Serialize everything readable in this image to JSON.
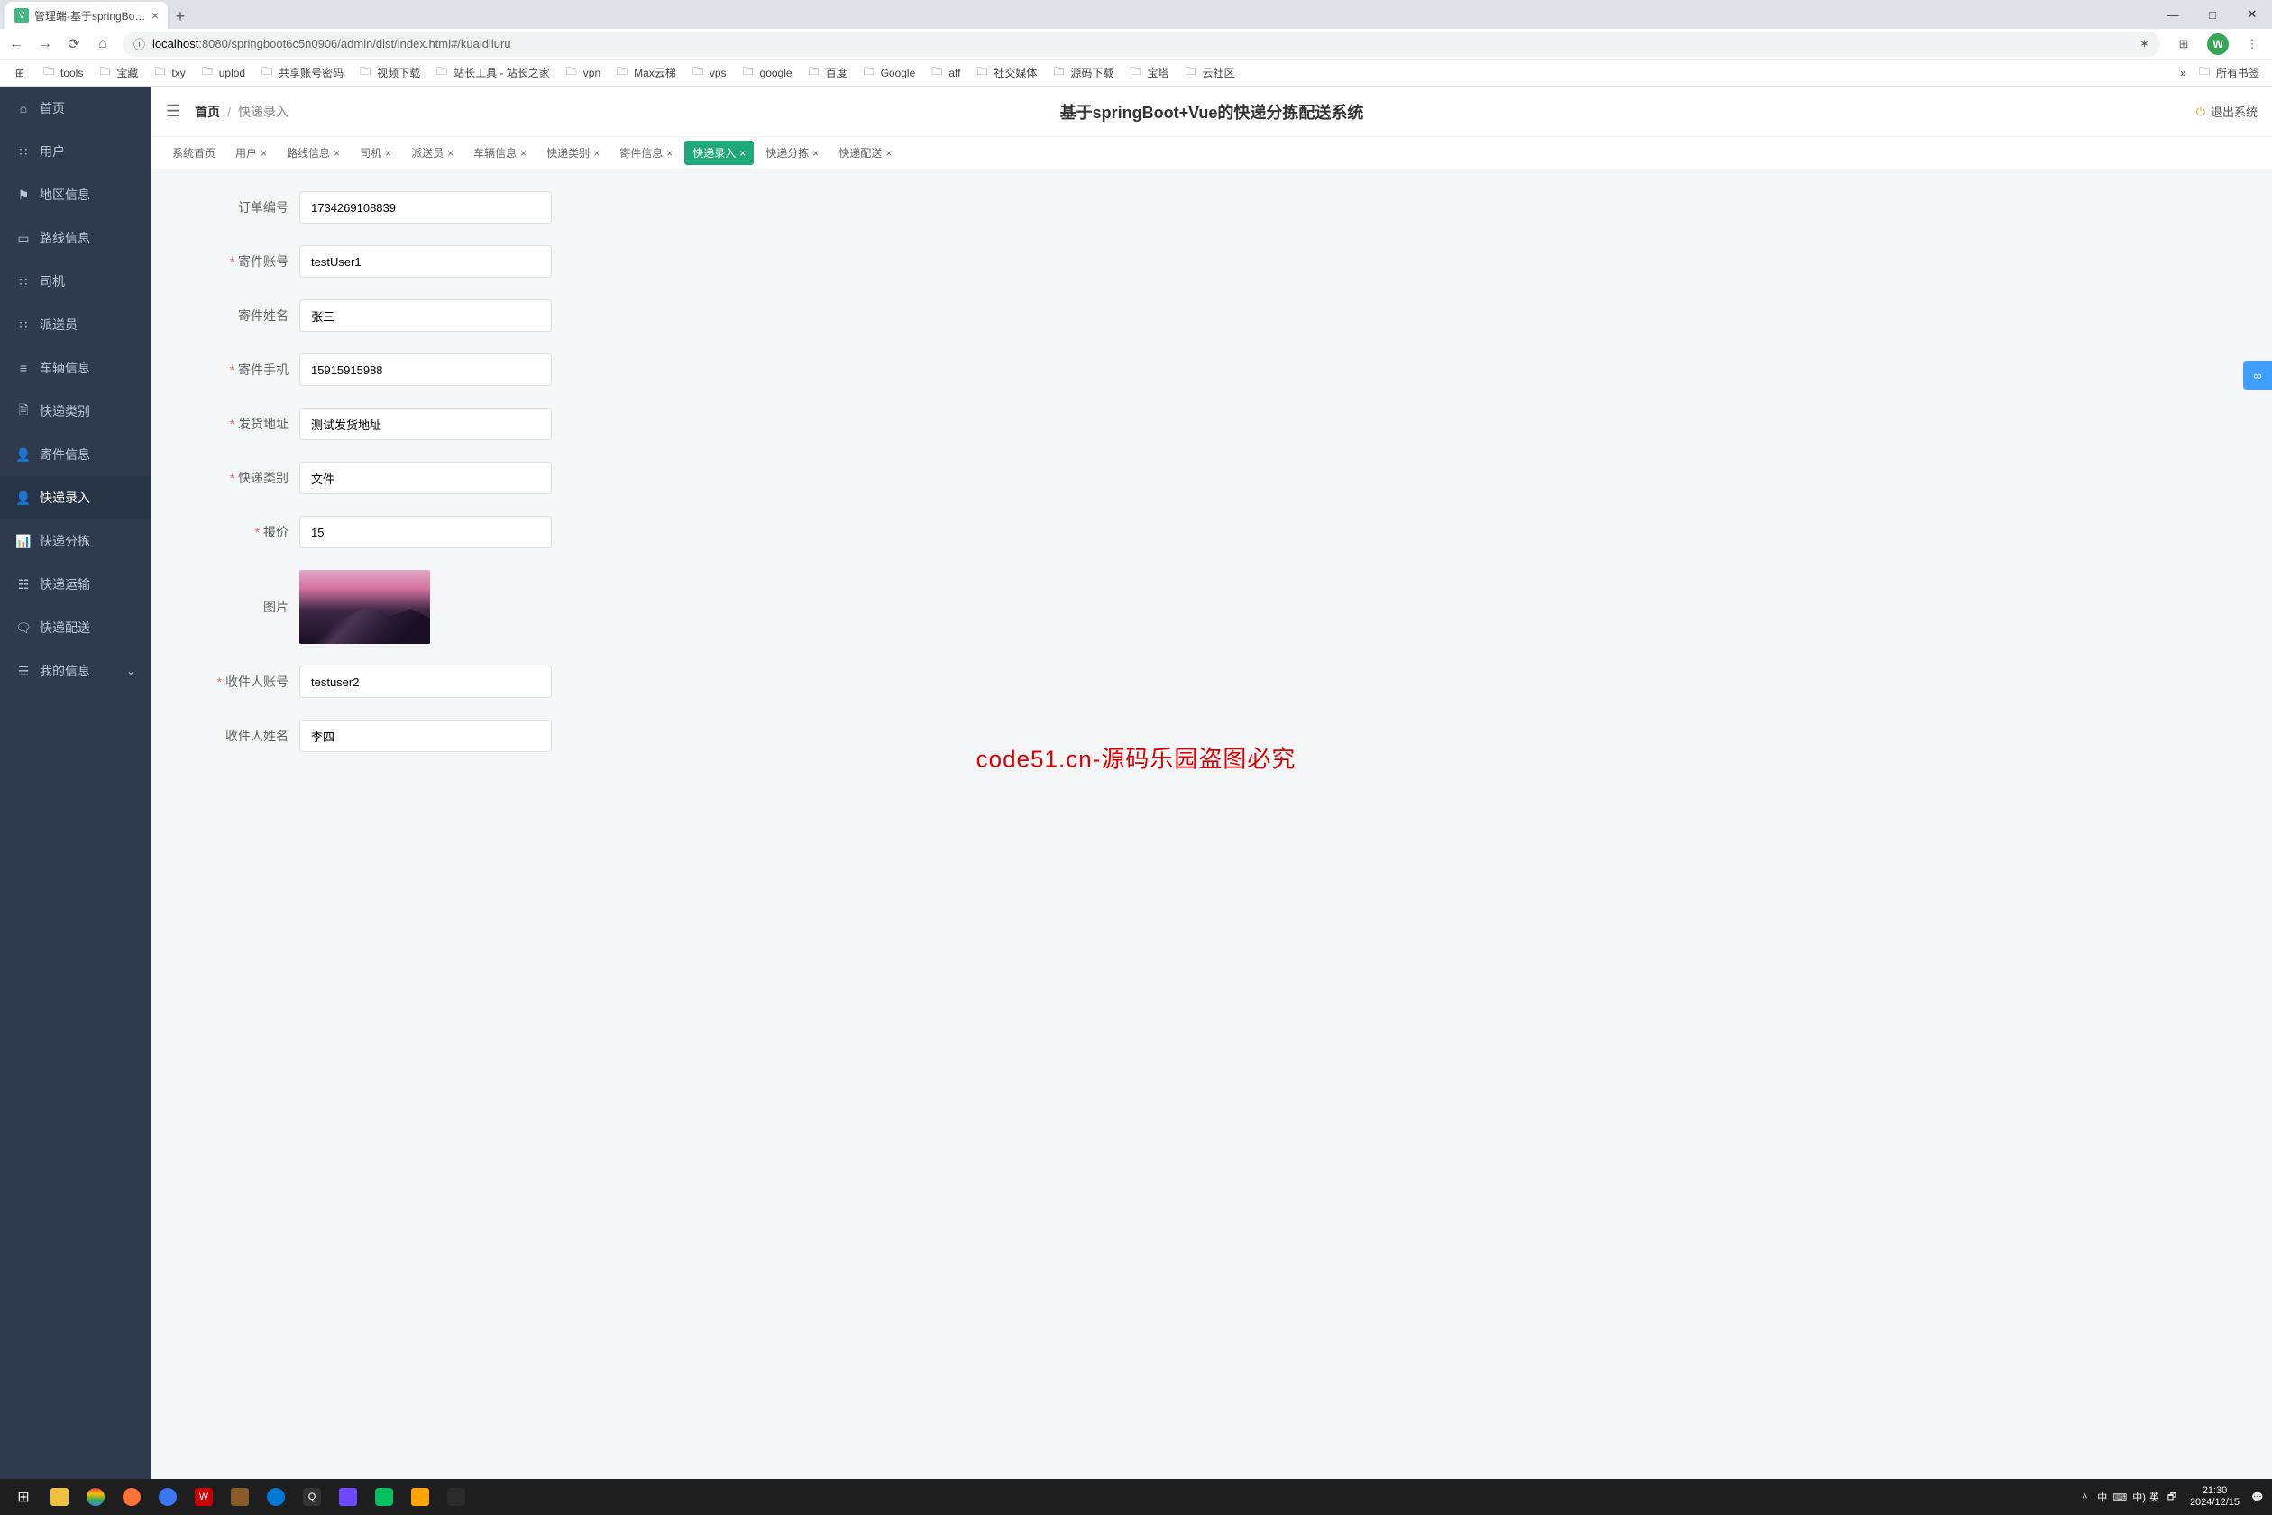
{
  "browser": {
    "tab_title": "管理端-基于springBoot+Vue的...",
    "url_host": "localhost",
    "url_path": ":8080/springboot6c5n0906/admin/dist/index.html#/kuaidiluru",
    "avatar_letter": "W"
  },
  "bookmarks": [
    "tools",
    "宝藏",
    "txy",
    "uplod",
    "共享账号密码",
    "视频下载",
    "站长工具 - 站长之家",
    "vpn",
    "Max云梯",
    "vps",
    "google",
    "百度",
    "Google",
    "aff",
    "社交媒体",
    "源码下载",
    "宝塔",
    "云社区"
  ],
  "bookmarks_more": "所有书签",
  "sidebar": [
    {
      "icon": "⌂",
      "label": "首页"
    },
    {
      "icon": "∷",
      "label": "用户"
    },
    {
      "icon": "⚑",
      "label": "地区信息"
    },
    {
      "icon": "▭",
      "label": "路线信息"
    },
    {
      "icon": "∷",
      "label": "司机"
    },
    {
      "icon": "∷",
      "label": "派送员"
    },
    {
      "icon": "≡",
      "label": "车辆信息"
    },
    {
      "icon": "🖹",
      "label": "快递类别"
    },
    {
      "icon": "👤",
      "label": "寄件信息"
    },
    {
      "icon": "👤",
      "label": "快递录入"
    },
    {
      "icon": "📊",
      "label": "快递分拣"
    },
    {
      "icon": "☷",
      "label": "快递运输"
    },
    {
      "icon": "🗨",
      "label": "快递配送"
    },
    {
      "icon": "☰",
      "label": "我的信息",
      "chevron": true
    }
  ],
  "header": {
    "breadcrumb_home": "首页",
    "breadcrumb_current": "快递录入",
    "system_title": "基于springBoot+Vue的快递分拣配送系统",
    "logout": "退出系统"
  },
  "tabs": [
    {
      "label": "系统首页",
      "closable": false
    },
    {
      "label": "用户",
      "closable": true
    },
    {
      "label": "路线信息",
      "closable": true
    },
    {
      "label": "司机",
      "closable": true
    },
    {
      "label": "派送员",
      "closable": true
    },
    {
      "label": "车辆信息",
      "closable": true
    },
    {
      "label": "快递类别",
      "closable": true
    },
    {
      "label": "寄件信息",
      "closable": true
    },
    {
      "label": "快递录入",
      "closable": true,
      "active": true
    },
    {
      "label": "快递分拣",
      "closable": true
    },
    {
      "label": "快递配送",
      "closable": true
    }
  ],
  "form": {
    "order_no": {
      "label": "订单编号",
      "value": "1734269108839",
      "required": false
    },
    "sender_account": {
      "label": "寄件账号",
      "value": "testUser1",
      "required": true
    },
    "sender_name": {
      "label": "寄件姓名",
      "value": "张三",
      "required": false
    },
    "sender_phone": {
      "label": "寄件手机",
      "value": "15915915988",
      "required": true
    },
    "ship_addr": {
      "label": "发货地址",
      "value": "测试发货地址",
      "required": true
    },
    "category": {
      "label": "快递类别",
      "value": "文件",
      "required": true
    },
    "price": {
      "label": "报价",
      "value": "15",
      "required": true
    },
    "image": {
      "label": "图片"
    },
    "recv_account": {
      "label": "收件人账号",
      "value": "testuser2",
      "required": true
    },
    "recv_name": {
      "label": "收件人姓名",
      "value": "李四",
      "required": false
    }
  },
  "watermark": {
    "text": "code51.cn",
    "center": "code51.cn-源码乐园盗图必究"
  },
  "taskbar": {
    "ime1": "中",
    "ime2": "⌨",
    "ime3": "中)",
    "ime4": "英",
    "time": "21:30",
    "date": "2024/12/15"
  }
}
